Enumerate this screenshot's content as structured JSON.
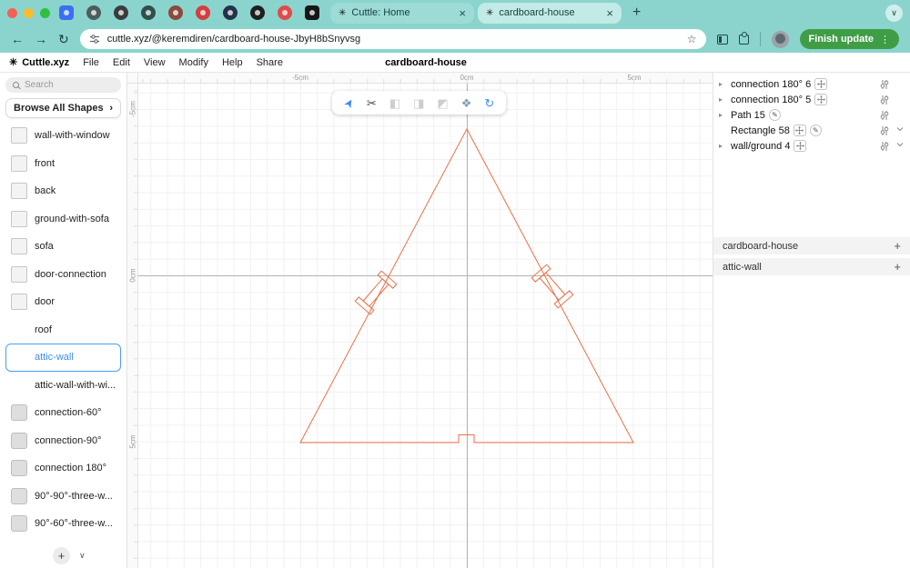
{
  "colors": {
    "chrome_teal": "#8bd4ce",
    "accent_blue": "#3f8cf3",
    "selection_blue": "#4b9df8",
    "shape_stroke": "#e8714a",
    "update_green": "#3f9d46"
  },
  "icons": {
    "logo": "✳",
    "close": "×",
    "new_tab": "+",
    "chevron_down": "∨",
    "chevron_right": "›",
    "back": "←",
    "forward": "→",
    "reload": "↻",
    "star": "☆",
    "dots": "⋮",
    "expander": "▸",
    "pencil": "✎",
    "plus": "+",
    "cursor": "➤",
    "knife": "✂",
    "bool_union": "◧",
    "bool_subtract": "◨",
    "bool_intersect": "◩",
    "path_tool": "❖",
    "rotate_tool": "↻"
  },
  "browser": {
    "tabs": [
      {
        "title": "Cuttle: Home"
      },
      {
        "title": "cardboard-house"
      }
    ],
    "url": "cuttle.xyz/@keremdiren/cardboard-house-JbyH8bSnyvsg",
    "update_button": "Finish update"
  },
  "menu": {
    "brand": "Cuttle.xyz",
    "items": [
      "File",
      "Edit",
      "View",
      "Modify",
      "Help",
      "Share"
    ],
    "doc_title": "cardboard-house"
  },
  "sidebar": {
    "search_placeholder": "Search",
    "browse_label": "Browse All Shapes",
    "items": [
      {
        "label": "wall-with-window"
      },
      {
        "label": "front"
      },
      {
        "label": "back"
      },
      {
        "label": "ground-with-sofa"
      },
      {
        "label": "sofa"
      },
      {
        "label": "door-connection"
      },
      {
        "label": "door"
      },
      {
        "label": "roof"
      },
      {
        "label": "attic-wall",
        "selected": true
      },
      {
        "label": "attic-wall-with-wi..."
      },
      {
        "label": "connection-60°"
      },
      {
        "label": "connection-90°"
      },
      {
        "label": "connection 180°"
      },
      {
        "label": "90°-90°-three-w..."
      },
      {
        "label": "90°-60°-three-w..."
      }
    ]
  },
  "canvas": {
    "ruler_h": [
      "-5cm",
      "0cm",
      "5cm"
    ],
    "ruler_v": [
      "-5cm",
      "0cm",
      "5cm"
    ]
  },
  "right_panel": {
    "objects": [
      {
        "name": "connection 180° 6"
      },
      {
        "name": "connection 180° 5"
      },
      {
        "name": "Path 15"
      },
      {
        "name": "Rectangle 58"
      },
      {
        "name": "wall/ground 4"
      }
    ],
    "sections": [
      {
        "name": "cardboard-house"
      },
      {
        "name": "attic-wall"
      }
    ]
  }
}
